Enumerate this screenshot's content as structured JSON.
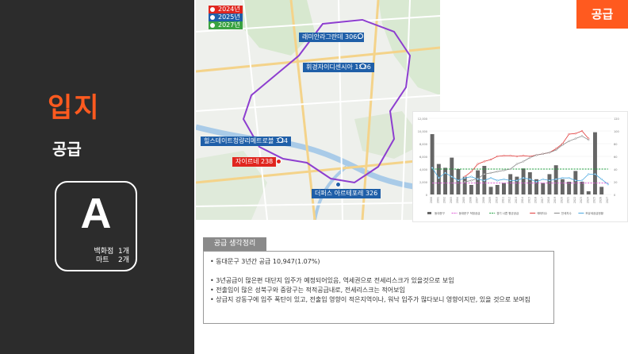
{
  "badge": "공급",
  "title": "입지",
  "subtitle": "공급",
  "grade": {
    "letter": "A",
    "stats": [
      "백화점  1개",
      "마트    2개"
    ]
  },
  "map": {
    "legend": [
      {
        "label": "2024년",
        "color": "#e0261f"
      },
      {
        "label": "2025년",
        "color": "#1f5fa8"
      },
      {
        "label": "2027년",
        "color": "#3aa241"
      }
    ],
    "labels": [
      {
        "text": "래미안라그란데  3069",
        "style": "blue"
      },
      {
        "text": "휘경자이디센시아  1806",
        "style": "blue"
      },
      {
        "text": "힐스테이트청량리메트로블  384",
        "style": "blue"
      },
      {
        "text": "자이르네  238",
        "style": "red"
      },
      {
        "text": "더퍼스 아르테포레  326",
        "style": "blue"
      }
    ]
  },
  "chart_data": {
    "type": "bar",
    "categories": [
      "2000",
      "2001",
      "2002",
      "2003",
      "2004",
      "2005",
      "2006",
      "2007",
      "2008",
      "2009",
      "2010",
      "2011",
      "2012",
      "2013",
      "2014",
      "2015",
      "2016",
      "2017",
      "2018",
      "2019",
      "2020",
      "2021",
      "2022",
      "2023",
      "2024",
      "2025",
      "2026",
      "2027"
    ],
    "ylim": [
      0,
      12000
    ],
    "y2lim": [
      0,
      120
    ],
    "yticks": [
      "12,000",
      "10,000",
      "8,000",
      "6,000",
      "4,000",
      "2,000",
      "0"
    ],
    "y2ticks": [
      "120",
      "100",
      "80",
      "60",
      "40",
      "20",
      "0"
    ],
    "series": [
      {
        "name": "동대문구",
        "kind": "bar",
        "color": "#666666",
        "values": [
          9500,
          4800,
          4200,
          5800,
          4000,
          2800,
          1500,
          3800,
          4500,
          1200,
          1500,
          1800,
          3200,
          2800,
          4100,
          3500,
          2400,
          1800,
          3200,
          4600,
          2400,
          2000,
          3700,
          2000,
          500,
          9800,
          1200,
          0
        ]
      },
      {
        "name": "동대문구 적정공급",
        "kind": "line",
        "color": "#e05ad8",
        "dashed": true,
        "values": [
          1800,
          1800,
          1800,
          1800,
          1800,
          1800,
          1800,
          1800,
          1800,
          1800,
          1800,
          1800,
          1800,
          1800,
          1800,
          1800,
          1800,
          1800,
          1800,
          1800,
          1800,
          1800,
          1800,
          1800,
          1800,
          1800,
          1800,
          1800
        ]
      },
      {
        "name": "경기 나쁜 평균공급",
        "kind": "line",
        "color": "#1a9e3a",
        "dashed": true,
        "values": [
          4000,
          4000,
          4000,
          4000,
          4000,
          4000,
          4000,
          4000,
          4000,
          4000,
          4000,
          4000,
          4000,
          4000,
          4000,
          4000,
          4000,
          4000,
          4000,
          4000,
          4000,
          4000,
          4000,
          4000,
          4000,
          4000,
          4000,
          4000
        ]
      },
      {
        "name": "매매지수",
        "kind": "line",
        "color": "#e03a3a",
        "axis": "right",
        "values": [
          null,
          null,
          null,
          null,
          null,
          28,
          36,
          48,
          52,
          55,
          60,
          61,
          61,
          60,
          61,
          60,
          62,
          64,
          66,
          72,
          80,
          95,
          96,
          100,
          88,
          null,
          null,
          null
        ]
      },
      {
        "name": "전세지수",
        "kind": "line",
        "color": "#888888",
        "axis": "right",
        "values": [
          null,
          null,
          null,
          null,
          null,
          20,
          22,
          25,
          32,
          34,
          36,
          38,
          40,
          48,
          52,
          58,
          62,
          64,
          66,
          70,
          78,
          84,
          88,
          92,
          86,
          null,
          null,
          null
        ]
      },
      {
        "name": "보유세공급현황",
        "kind": "line",
        "color": "#4aa8e0",
        "values": [
          4200,
          2600,
          3400,
          2800,
          2200,
          2600,
          2800,
          2400,
          2200,
          2600,
          2200,
          2400,
          2200,
          2200,
          2600,
          2400,
          2000,
          2400,
          2200,
          2400,
          2600,
          2600,
          2200,
          2200,
          3200,
          3200,
          2400,
          1600
        ]
      }
    ]
  },
  "notes": {
    "header": "공급 생각정리",
    "items": [
      "동대문구 3년간 공급 10,947(1.07%)",
      "3년공급이 많은편  대단지 입주가 예정되어있음, 역세권으로 전세리스크가 있을것으로 보임",
      "전출입이 많은 성북구와 중랑구는 적적공급내로, 전세리스크는 적어보임",
      "상급지 강동구에 입주 폭탄이 있고, 전출입 영향이 적은지역이나, 워낙 입주가 많다보니 영향이지만, 있을 것으로 보여짐"
    ]
  }
}
